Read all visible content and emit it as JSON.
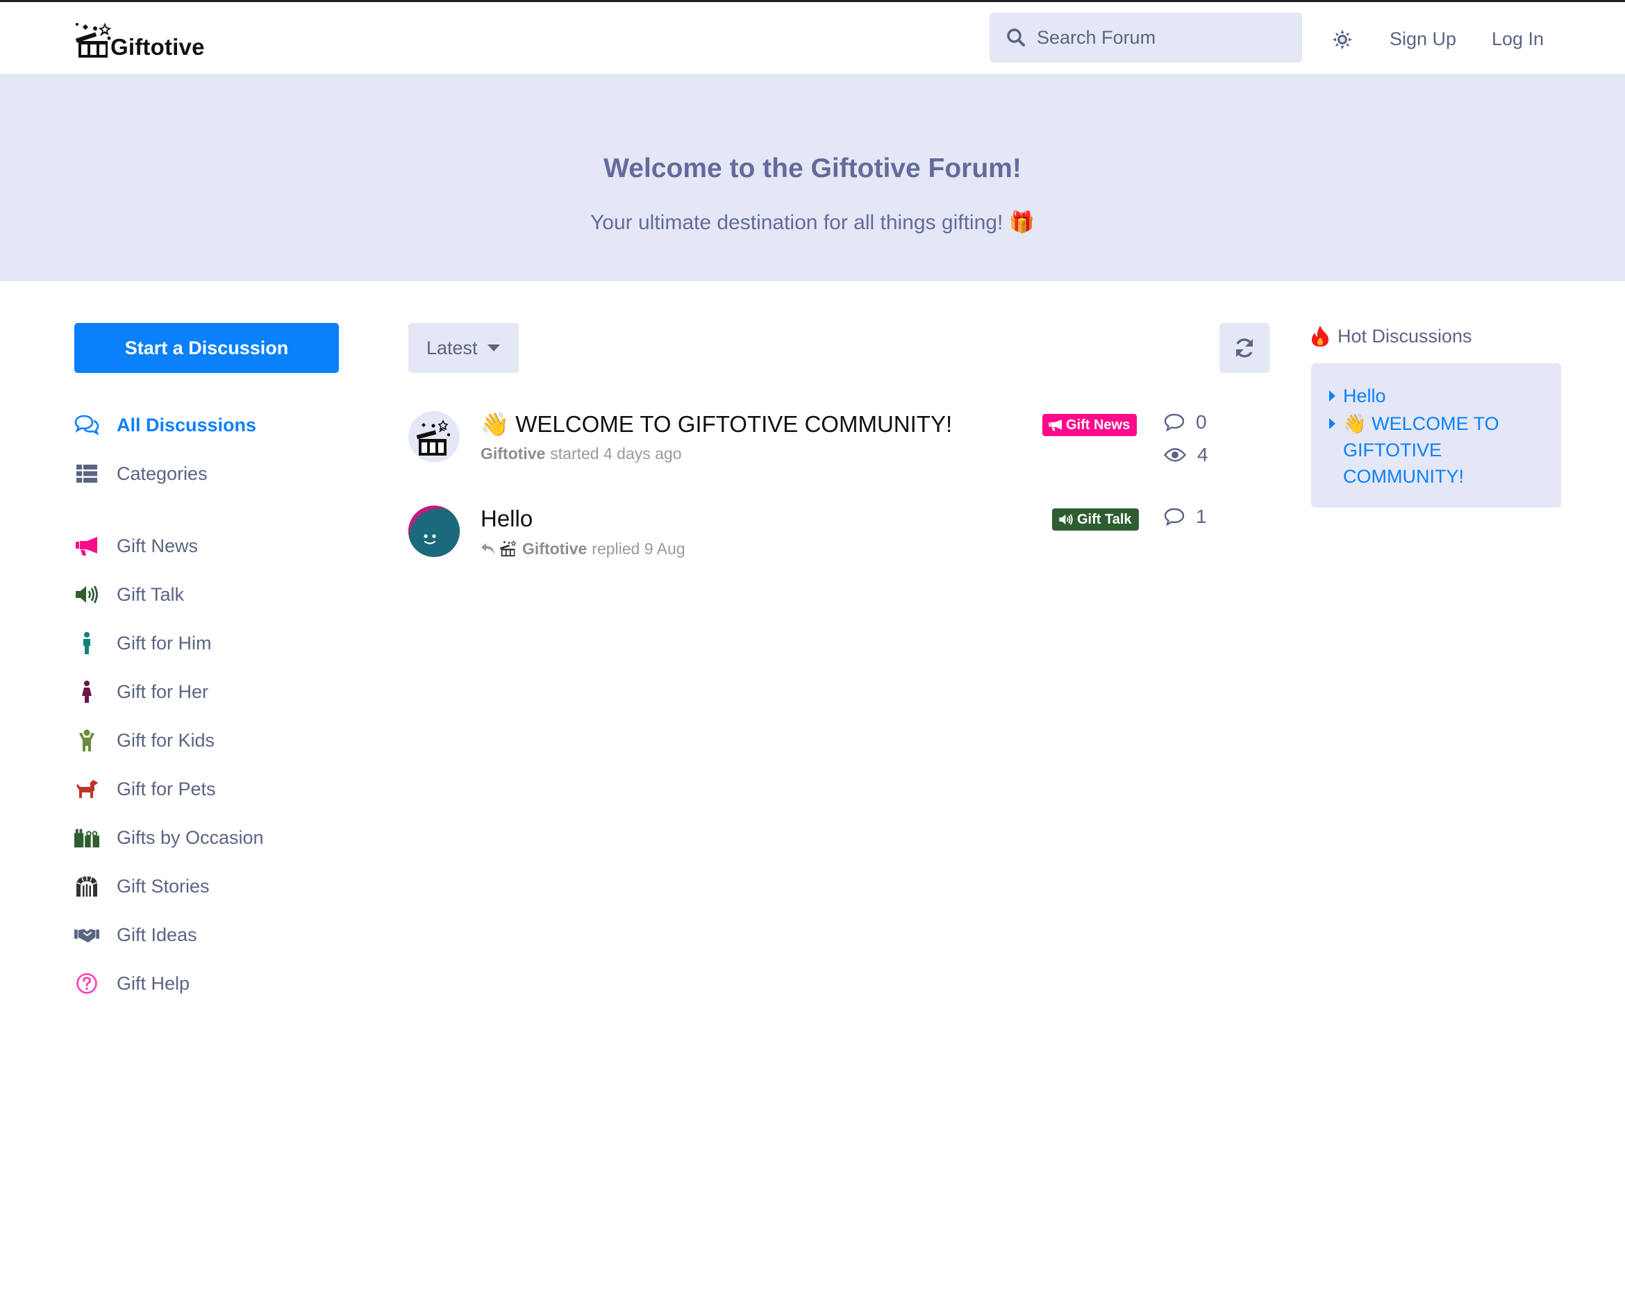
{
  "header": {
    "brand": "Giftotive",
    "search_placeholder": "Search Forum",
    "signup_label": "Sign Up",
    "login_label": "Log In"
  },
  "hero": {
    "title": "Welcome to the Giftotive Forum!",
    "subtitle": "Your ultimate destination for all things gifting! 🎁"
  },
  "sidebar": {
    "start_label": "Start a Discussion",
    "items": [
      {
        "label": "All Discussions",
        "icon": "comments-icon",
        "color": "#0b80fb"
      },
      {
        "label": "Categories",
        "icon": "list-icon",
        "color": "#5b6483"
      },
      {
        "label": "Gift News",
        "icon": "bullhorn-icon",
        "color": "#ff0a8a"
      },
      {
        "label": "Gift Talk",
        "icon": "volume-icon",
        "color": "#2e5e30"
      },
      {
        "label": "Gift for Him",
        "icon": "male-icon",
        "color": "#138177"
      },
      {
        "label": "Gift for Her",
        "icon": "female-icon",
        "color": "#6b1648"
      },
      {
        "label": "Gift for Kids",
        "icon": "child-icon",
        "color": "#6c8b3e"
      },
      {
        "label": "Gift for Pets",
        "icon": "dog-icon",
        "color": "#c1322e"
      },
      {
        "label": "Gifts by Occasion",
        "icon": "gifts-icon",
        "color": "#2e5e30"
      },
      {
        "label": "Gift Stories",
        "icon": "dungeon-icon",
        "color": "#333333"
      },
      {
        "label": "Gift Ideas",
        "icon": "handshake-icon",
        "color": "#5b6483"
      },
      {
        "label": "Gift Help",
        "icon": "question-circle-icon",
        "color": "#ff3fb4"
      }
    ]
  },
  "toolbar": {
    "sort_label": "Latest"
  },
  "discussions": [
    {
      "title": "👋 WELCOME TO GIFTOTIVE COMMUNITY!",
      "author": "Giftotive",
      "action": "started 4 days ago",
      "tag": "Gift News",
      "tag_color": "#ff0a8a",
      "replies": "0",
      "views": "4"
    },
    {
      "title": "Hello",
      "author": "Giftotive",
      "action": "replied 9 Aug",
      "tag": "Gift Talk",
      "tag_color": "#2e5e30",
      "replies": "1"
    }
  ],
  "hot": {
    "title": "Hot Discussions",
    "items": [
      "Hello",
      "👋 WELCOME TO GIFTOTIVE COMMUNITY!"
    ]
  }
}
